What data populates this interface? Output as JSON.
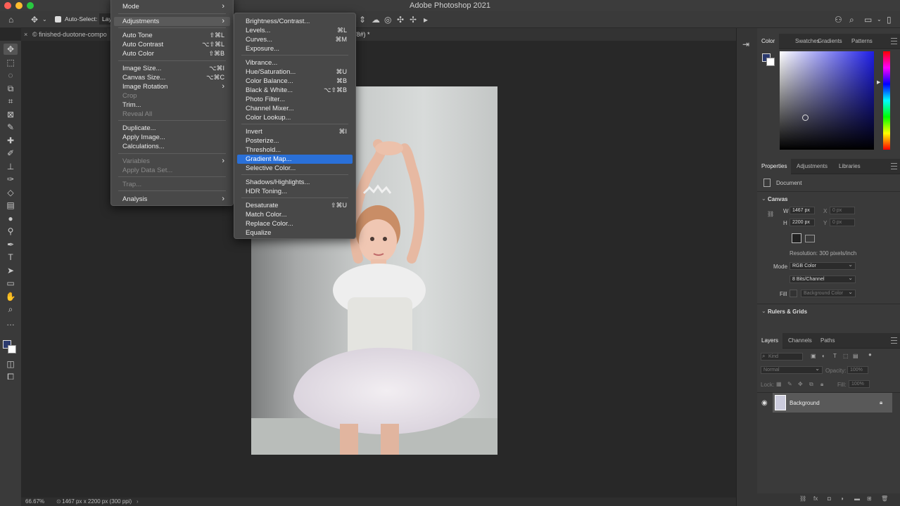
{
  "app": {
    "title": "Adobe Photoshop 2021"
  },
  "options_bar": {
    "auto_select_label": "Auto-Select:",
    "auto_select_value": "Lay"
  },
  "document_tab": {
    "title": "© finished-duotone-compo",
    "tab_suffix": "/8#) *"
  },
  "image_menu": {
    "items": [
      {
        "label": "Mode",
        "shortcut": "",
        "submenu": true,
        "enabled": true
      },
      {
        "label": "Adjustments",
        "shortcut": "",
        "submenu": true,
        "enabled": true,
        "active": true
      },
      {
        "label": "Auto Tone",
        "shortcut": "⇧⌘L",
        "enabled": true
      },
      {
        "label": "Auto Contrast",
        "shortcut": "⌥⇧⌘L",
        "enabled": true
      },
      {
        "label": "Auto Color",
        "shortcut": "⇧⌘B",
        "enabled": true
      },
      {
        "label": "Image Size...",
        "shortcut": "⌥⌘I",
        "enabled": true
      },
      {
        "label": "Canvas Size...",
        "shortcut": "⌥⌘C",
        "enabled": true
      },
      {
        "label": "Image Rotation",
        "shortcut": "",
        "submenu": true,
        "enabled": true
      },
      {
        "label": "Crop",
        "shortcut": "",
        "enabled": false
      },
      {
        "label": "Trim...",
        "shortcut": "",
        "enabled": true
      },
      {
        "label": "Reveal All",
        "shortcut": "",
        "enabled": false
      },
      {
        "label": "Duplicate...",
        "shortcut": "",
        "enabled": true
      },
      {
        "label": "Apply Image...",
        "shortcut": "",
        "enabled": true
      },
      {
        "label": "Calculations...",
        "shortcut": "",
        "enabled": true
      },
      {
        "label": "Variables",
        "shortcut": "",
        "submenu": true,
        "enabled": false
      },
      {
        "label": "Apply Data Set...",
        "shortcut": "",
        "enabled": false
      },
      {
        "label": "Trap...",
        "shortcut": "",
        "enabled": false
      },
      {
        "label": "Analysis",
        "shortcut": "",
        "submenu": true,
        "enabled": true
      }
    ]
  },
  "adjustments_menu": {
    "items": [
      {
        "label": "Brightness/Contrast...",
        "shortcut": ""
      },
      {
        "label": "Levels...",
        "shortcut": "⌘L"
      },
      {
        "label": "Curves...",
        "shortcut": "⌘M"
      },
      {
        "label": "Exposure...",
        "shortcut": ""
      },
      {
        "label": "Vibrance...",
        "shortcut": ""
      },
      {
        "label": "Hue/Saturation...",
        "shortcut": "⌘U"
      },
      {
        "label": "Color Balance...",
        "shortcut": "⌘B"
      },
      {
        "label": "Black & White...",
        "shortcut": "⌥⇧⌘B"
      },
      {
        "label": "Photo Filter...",
        "shortcut": ""
      },
      {
        "label": "Channel Mixer...",
        "shortcut": ""
      },
      {
        "label": "Color Lookup...",
        "shortcut": ""
      },
      {
        "label": "Invert",
        "shortcut": "⌘I"
      },
      {
        "label": "Posterize...",
        "shortcut": ""
      },
      {
        "label": "Threshold...",
        "shortcut": ""
      },
      {
        "label": "Gradient Map...",
        "shortcut": "",
        "highlighted": true
      },
      {
        "label": "Selective Color...",
        "shortcut": ""
      },
      {
        "label": "Shadows/Highlights...",
        "shortcut": ""
      },
      {
        "label": "HDR Toning...",
        "shortcut": ""
      },
      {
        "label": "Desaturate",
        "shortcut": "⇧⌘U"
      },
      {
        "label": "Match Color...",
        "shortcut": ""
      },
      {
        "label": "Replace Color...",
        "shortcut": ""
      },
      {
        "label": "Equalize",
        "shortcut": ""
      }
    ]
  },
  "color_panel": {
    "tabs": [
      "Color",
      "Swatches",
      "Gradients",
      "Patterns"
    ],
    "active_tab": "Color"
  },
  "properties_panel": {
    "tabs": [
      "Properties",
      "Adjustments",
      "Libraries"
    ],
    "doc_label": "Document",
    "canvas_section": "Canvas",
    "w_label": "W",
    "w_value": "1467 px",
    "h_label": "H",
    "h_value": "2200 px",
    "x_label": "X",
    "x_value": "0 px",
    "y_label": "Y",
    "y_value": "0 px",
    "resolution": "Resolution: 300 pixels/inch",
    "mode_label": "Mode",
    "mode_value": "RGB Color",
    "bits_value": "8 Bits/Channel",
    "fill_label": "Fill",
    "fill_value": "Background Color",
    "rulers_section": "Rulers & Grids"
  },
  "layers_panel": {
    "tabs": [
      "Layers",
      "Channels",
      "Paths"
    ],
    "kind_placeholder": "Kind",
    "blend_mode": "Normal",
    "opacity_label": "Opacity:",
    "opacity_value": "100%",
    "lock_label": "Lock:",
    "fill_label": "Fill:",
    "fill_value": "100%",
    "layers": [
      {
        "name": "Background",
        "visible": true,
        "locked": true
      }
    ]
  },
  "status_bar": {
    "zoom": "66.67%",
    "doc_info": "1467 px x 2200 px (300 ppi)"
  },
  "colors": {
    "accent": "#2a70d8",
    "menu_bg": "#484848",
    "panel_bg": "#3a3a3a",
    "canvas_bg": "#282828"
  }
}
